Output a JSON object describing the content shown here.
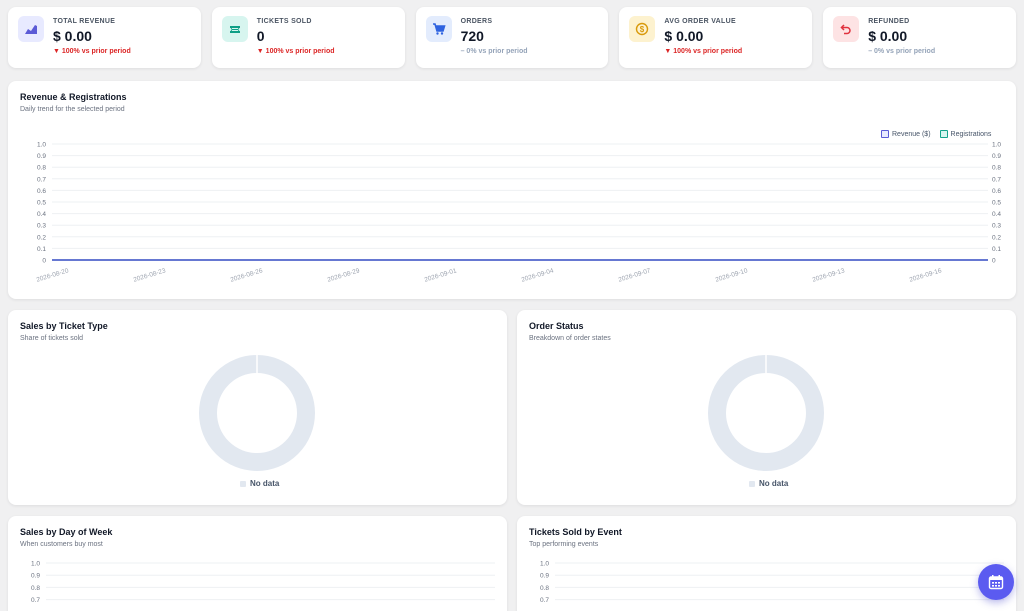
{
  "kpis": [
    {
      "label": "TOTAL REVENUE",
      "value": "$ 0.00",
      "delta": "▼ 100% vs prior period",
      "trend": "down",
      "icon": "chart-icon",
      "bg": "#e8eaff",
      "fg": "#5b5bd6"
    },
    {
      "label": "TICKETS SOLD",
      "value": "0",
      "delta": "▼ 100% vs prior period",
      "trend": "down",
      "icon": "ticket-icon",
      "bg": "#d7f5ef",
      "fg": "#0f9f86"
    },
    {
      "label": "ORDERS",
      "value": "720",
      "delta": "– 0% vs prior period",
      "trend": "flat",
      "icon": "cart-icon",
      "bg": "#e3ecfd",
      "fg": "#2f63e0"
    },
    {
      "label": "AVG ORDER VALUE",
      "value": "$ 0.00",
      "delta": "▼ 100% vs prior period",
      "trend": "down",
      "icon": "dollar-icon",
      "bg": "#fdf2cf",
      "fg": "#d99a0c"
    },
    {
      "label": "REFUNDED",
      "value": "$ 0.00",
      "delta": "– 0% vs prior period",
      "trend": "flat",
      "icon": "refund-icon",
      "bg": "#fde3e4",
      "fg": "#e0323e"
    }
  ],
  "revenue_card": {
    "title": "Revenue & Registrations",
    "subtitle": "Daily trend for the selected period"
  },
  "sales_ticket_card": {
    "title": "Sales by Ticket Type",
    "subtitle": "Share of tickets sold",
    "nodata": "No data"
  },
  "order_status_card": {
    "title": "Order Status",
    "subtitle": "Breakdown of order states",
    "nodata": "No data"
  },
  "weekday_card": {
    "title": "Sales by Day of Week",
    "subtitle": "When customers buy most"
  },
  "event_card": {
    "title": "Tickets Sold by Event",
    "subtitle": "Top performing events"
  },
  "colors": {
    "revenue": "#5b5bd6",
    "registrations": "#14a38b",
    "grid": "#eef0f3",
    "donut": "#e2e8f0",
    "fab": "#5b5bf0"
  },
  "chart_data": [
    {
      "type": "line",
      "title": "Revenue & Registrations",
      "y_ticks": [
        "0",
        "0.1",
        "0.2",
        "0.3",
        "0.4",
        "0.5",
        "0.6",
        "0.7",
        "0.8",
        "0.9",
        "1.0"
      ],
      "ylim": [
        0,
        1
      ],
      "x_ticks": [
        "2026-08-20",
        "2026-08-23",
        "2026-08-26",
        "2026-08-29",
        "2026-09-01",
        "2026-09-04",
        "2026-09-07",
        "2026-09-10",
        "2026-09-13",
        "2026-09-16"
      ],
      "series": [
        {
          "name": "Revenue ($)",
          "values": [
            0,
            0
          ]
        },
        {
          "name": "Registrations",
          "values": [
            0,
            0
          ]
        }
      ],
      "legend": "top-right"
    },
    {
      "type": "pie",
      "title": "Sales by Ticket Type",
      "values": []
    },
    {
      "type": "pie",
      "title": "Order Status",
      "values": []
    },
    {
      "type": "bar",
      "title": "Sales by Day of Week",
      "y_ticks": [
        "1.0",
        "0.9",
        "0.8",
        "0.7"
      ],
      "values": []
    },
    {
      "type": "bar",
      "title": "Tickets Sold by Event",
      "y_ticks": [
        "1.0",
        "0.9",
        "0.8",
        "0.7"
      ],
      "values": []
    }
  ]
}
